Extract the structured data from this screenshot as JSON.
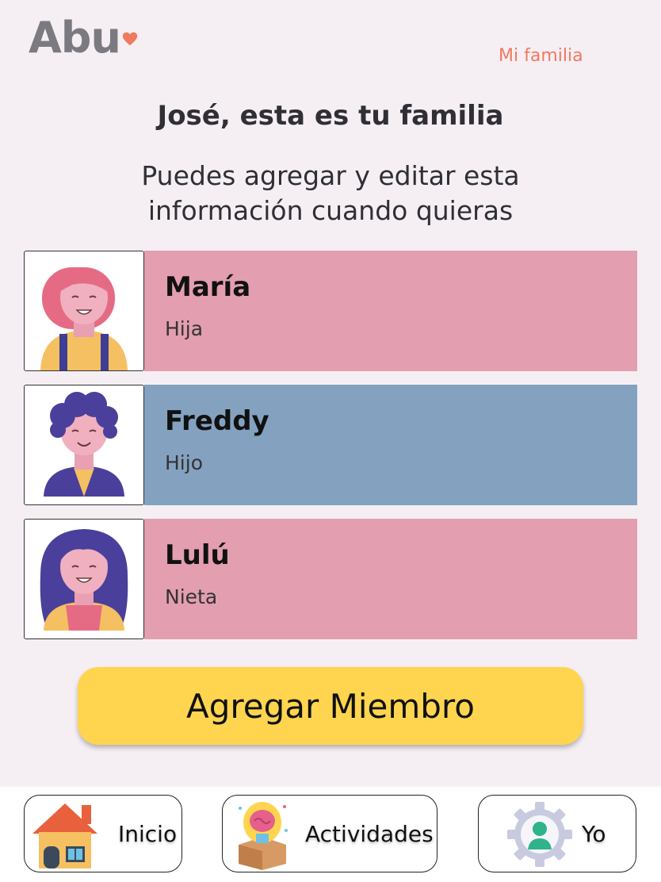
{
  "header": {
    "logo_text": "Abu",
    "nav_link": "Mi familia"
  },
  "main": {
    "title": "José, esta es tu familia",
    "subtitle": "Puedes agregar y editar esta información cuando quieras"
  },
  "members": [
    {
      "name": "María",
      "role": "Hija",
      "color": "#e39eb0",
      "avatar": "girl-avatar-icon"
    },
    {
      "name": "Freddy",
      "role": "Hijo",
      "color": "#84a2c0",
      "avatar": "boy-avatar-icon"
    },
    {
      "name": "Lulú",
      "role": "Nieta",
      "color": "#e39eb0",
      "avatar": "granddaughter-avatar-icon"
    }
  ],
  "add_button": {
    "label": "Agregar Miembro"
  },
  "bottom_nav": {
    "tabs": [
      {
        "label": "Inicio",
        "icon": "house-icon"
      },
      {
        "label": "Actividades",
        "icon": "brain-box-icon"
      },
      {
        "label": "Yo",
        "icon": "user-gear-icon"
      }
    ]
  },
  "colors": {
    "background": "#f5eff4",
    "accent": "#f07a5e",
    "button": "#ffd54f",
    "pink_card": "#e39eb0",
    "blue_card": "#84a2c0"
  }
}
